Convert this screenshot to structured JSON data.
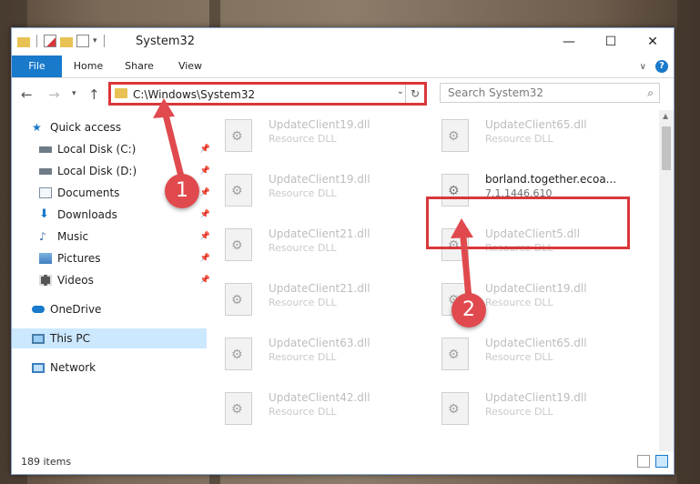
{
  "window": {
    "title": "System32"
  },
  "caption": {
    "minimize": "—",
    "maximize": "☐",
    "close": "✕"
  },
  "ribbon": {
    "tabs": [
      "File",
      "Home",
      "Share",
      "View"
    ]
  },
  "navigation": {
    "address": "C:\\Windows\\System32",
    "search_placeholder": "Search System32"
  },
  "sidebar": {
    "items": [
      {
        "label": "Quick access",
        "icon": "star-icon",
        "pinned": false
      },
      {
        "label": "Local Disk (C:)",
        "icon": "drive-icon",
        "pinned": true
      },
      {
        "label": "Local Disk (D:)",
        "icon": "drive-icon",
        "pinned": true
      },
      {
        "label": "Documents",
        "icon": "document-icon",
        "pinned": true
      },
      {
        "label": "Downloads",
        "icon": "download-icon",
        "pinned": true
      },
      {
        "label": "Music",
        "icon": "music-icon",
        "pinned": true
      },
      {
        "label": "Pictures",
        "icon": "pictures-icon",
        "pinned": true
      },
      {
        "label": "Videos",
        "icon": "video-icon",
        "pinned": true
      },
      {
        "label": "OneDrive",
        "icon": "cloud-icon",
        "pinned": false
      },
      {
        "label": "This PC",
        "icon": "computer-icon",
        "pinned": false,
        "selected": true
      },
      {
        "label": "Network",
        "icon": "network-icon",
        "pinned": false
      }
    ]
  },
  "files": [
    {
      "name": "UpdateClient19.dll",
      "type": "Resource DLL"
    },
    {
      "name": "UpdateClient65.dll",
      "type": "Resource DLL"
    },
    {
      "name": "UpdateClient19.dll",
      "type": "Resource DLL"
    },
    {
      "name": "borland.together.ecoa...",
      "type": "7.1.1446.610",
      "highlighted": true
    },
    {
      "name": "UpdateClient21.dll",
      "type": "Resource DLL"
    },
    {
      "name": "UpdateClient5.dll",
      "type": "Resource DLL"
    },
    {
      "name": "UpdateClient21.dll",
      "type": "Resource DLL"
    },
    {
      "name": "UpdateClient19.dll",
      "type": "Resource DLL"
    },
    {
      "name": "UpdateClient63.dll",
      "type": "Resource DLL"
    },
    {
      "name": "UpdateClient65.dll",
      "type": "Resource DLL"
    },
    {
      "name": "UpdateClient42.dll",
      "type": "Resource DLL"
    },
    {
      "name": "UpdateClient19.dll",
      "type": "Resource DLL"
    }
  ],
  "status": {
    "items_count": "189 items"
  },
  "callouts": [
    "1",
    "2"
  ],
  "colors": {
    "accent": "#1979ca",
    "highlight_red": "#d9373b",
    "selected_bg": "#cce8ff"
  }
}
